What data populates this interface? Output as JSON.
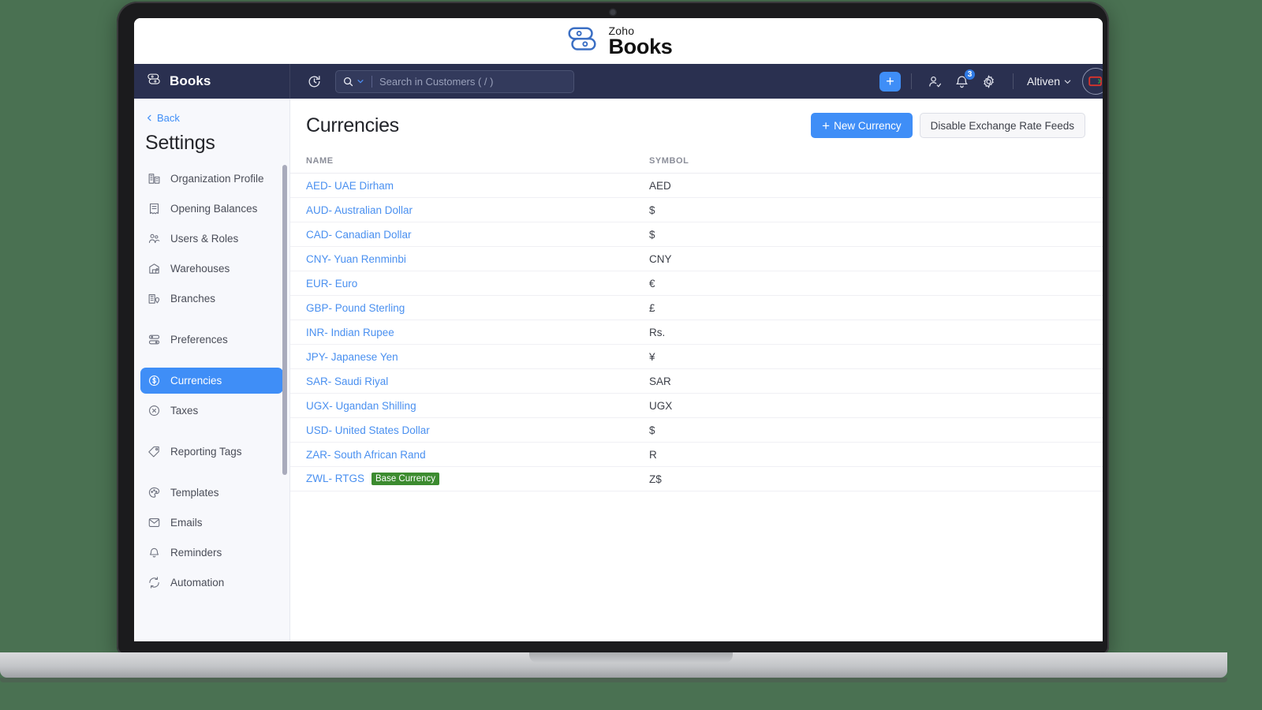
{
  "brand": {
    "zoho": "Zoho",
    "books": "Books",
    "logo_icon": "zoho-books-logo-icon"
  },
  "topnav": {
    "app_name": "Books",
    "app_logo_icon": "books-logo-icon",
    "refresh_icon": "refresh-clock-icon",
    "search": {
      "icon": "search-icon",
      "chevron_icon": "chevron-down-icon",
      "placeholder": "Search in Customers ( / )",
      "value": ""
    },
    "plus_label": "+",
    "icons": {
      "add_user": "add-user-icon",
      "bell": "bell-icon",
      "gear": "gear-icon"
    },
    "notification_count": "3",
    "org_name": "Altiven",
    "org_chevron_icon": "chevron-down-icon",
    "avatar_icon": "user-avatar-icon"
  },
  "sidebar": {
    "back_label": "Back",
    "back_icon": "chevron-left-icon",
    "title": "Settings",
    "items": [
      {
        "label": "Organization Profile",
        "icon": "organization-icon",
        "active": false,
        "gap_after": false
      },
      {
        "label": "Opening Balances",
        "icon": "opening-balances-icon",
        "active": false,
        "gap_after": false
      },
      {
        "label": "Users & Roles",
        "icon": "users-roles-icon",
        "active": false,
        "gap_after": false
      },
      {
        "label": "Warehouses",
        "icon": "warehouse-icon",
        "active": false,
        "gap_after": false
      },
      {
        "label": "Branches",
        "icon": "branches-icon",
        "active": false,
        "gap_after": true
      },
      {
        "label": "Preferences",
        "icon": "preferences-icon",
        "active": false,
        "gap_after": true
      },
      {
        "label": "Currencies",
        "icon": "currency-dollar-icon",
        "active": true,
        "gap_after": false
      },
      {
        "label": "Taxes",
        "icon": "taxes-percent-icon",
        "active": false,
        "gap_after": true
      },
      {
        "label": "Reporting Tags",
        "icon": "tag-icon",
        "active": false,
        "gap_after": true
      },
      {
        "label": "Templates",
        "icon": "palette-icon",
        "active": false,
        "gap_after": false
      },
      {
        "label": "Emails",
        "icon": "email-icon",
        "active": false,
        "gap_after": false
      },
      {
        "label": "Reminders",
        "icon": "bell-icon",
        "active": false,
        "gap_after": false
      },
      {
        "label": "Automation",
        "icon": "automation-refresh-icon",
        "active": false,
        "gap_after": false
      }
    ]
  },
  "main": {
    "title": "Currencies",
    "new_currency_label": "New Currency",
    "new_currency_icon": "plus-icon",
    "disable_feeds_label": "Disable Exchange Rate Feeds",
    "columns": [
      "NAME",
      "SYMBOL"
    ],
    "rows": [
      {
        "name": "AED- UAE Dirham",
        "symbol": "AED",
        "badge": ""
      },
      {
        "name": "AUD- Australian Dollar",
        "symbol": "$",
        "badge": ""
      },
      {
        "name": "CAD- Canadian Dollar",
        "symbol": "$",
        "badge": ""
      },
      {
        "name": "CNY- Yuan Renminbi",
        "symbol": "CNY",
        "badge": ""
      },
      {
        "name": "EUR- Euro",
        "symbol": "€",
        "badge": ""
      },
      {
        "name": "GBP- Pound Sterling",
        "symbol": "£",
        "badge": ""
      },
      {
        "name": "INR- Indian Rupee",
        "symbol": "Rs.",
        "badge": ""
      },
      {
        "name": "JPY- Japanese Yen",
        "symbol": "¥",
        "badge": ""
      },
      {
        "name": "SAR- Saudi Riyal",
        "symbol": "SAR",
        "badge": ""
      },
      {
        "name": "UGX- Ugandan Shilling",
        "symbol": "UGX",
        "badge": ""
      },
      {
        "name": "USD- United States Dollar",
        "symbol": "$",
        "badge": ""
      },
      {
        "name": "ZAR- South African Rand",
        "symbol": "R",
        "badge": ""
      },
      {
        "name": "ZWL- RTGS",
        "symbol": "Z$",
        "badge": "Base Currency"
      }
    ]
  },
  "colors": {
    "page_background": "#4a7152",
    "topnav": "#2a3050",
    "accent_blue": "#3f8ef7",
    "link_blue": "#4a90f0",
    "badge_green": "#3c8b2f",
    "sidebar_bg": "#f7f8fc"
  }
}
